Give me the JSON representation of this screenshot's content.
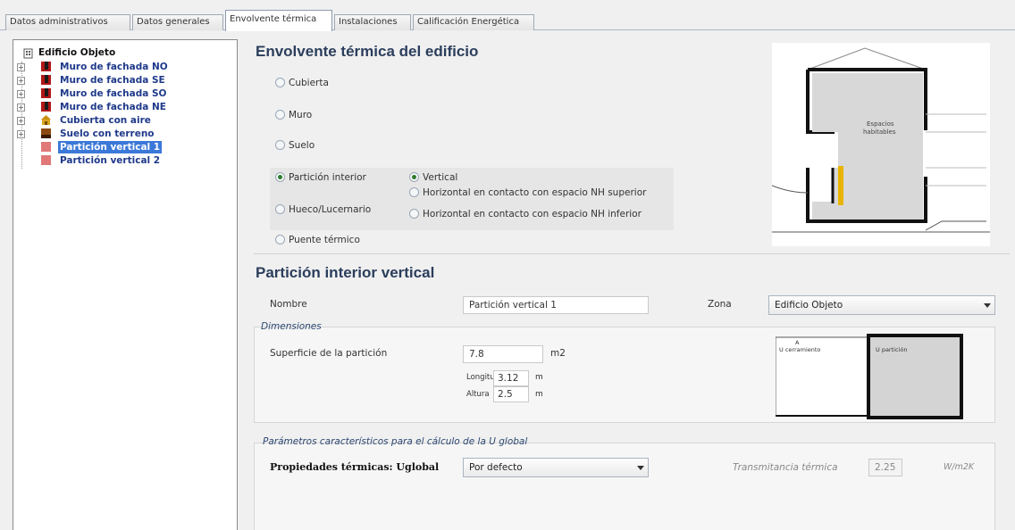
{
  "tabs": [
    "Datos administrativos",
    "Datos generales",
    "Envolvente térmica",
    "Instalaciones",
    "Calificación Energética"
  ],
  "tree": {
    "root": "Edificio Objeto",
    "items": [
      {
        "label": "Muro de fachada NO",
        "icon": "wall-icon"
      },
      {
        "label": "Muro de fachada SE",
        "icon": "wall-icon"
      },
      {
        "label": "Muro de fachada SO",
        "icon": "wall-icon"
      },
      {
        "label": "Muro de fachada NE",
        "icon": "wall-icon"
      },
      {
        "label": "Cubierta con aire",
        "icon": "roof-icon"
      },
      {
        "label": "Suelo con terreno",
        "icon": "floor-icon"
      },
      {
        "label": "Partición vertical 1",
        "icon": "partition-icon",
        "selected": true
      },
      {
        "label": "Partición vertical 2",
        "icon": "partition-icon"
      }
    ]
  },
  "envelope": {
    "title": "Envolvente térmica del edificio",
    "types": [
      {
        "label": "Cubierta",
        "checked": false
      },
      {
        "label": "Muro",
        "checked": false
      },
      {
        "label": "Suelo",
        "checked": false
      },
      {
        "label": "Partición interior",
        "checked": true
      },
      {
        "label": "Hueco/Lucernario",
        "checked": false
      },
      {
        "label": "Puente térmico",
        "checked": false
      }
    ],
    "subtypes": [
      {
        "label": "Vertical",
        "checked": true
      },
      {
        "label": "Horizontal en contacto con espacio NH superior",
        "checked": false
      },
      {
        "label": "Horizontal en contacto con espacio NH inferior",
        "checked": false
      }
    ],
    "diagram": {
      "label_line1": "Espacios",
      "label_line2": "habitables"
    }
  },
  "partition": {
    "title": "Partición interior vertical",
    "name_label": "Nombre",
    "name_value": "Partición vertical 1",
    "zone_label": "Zona",
    "zone_value": "Edificio Objeto",
    "dimensions": {
      "title": "Dimensiones",
      "surface_label": "Superficie de la partición",
      "surface_value": "7.8",
      "surface_unit": "m2",
      "length_label": "Longitud",
      "length_value": "3.12",
      "length_unit": "m",
      "height_label": "Altura",
      "height_value": "2.5",
      "height_unit": "m",
      "preview_left": "U cerramiento",
      "preview_right": "U partición",
      "preview_top": "A"
    },
    "params": {
      "title": "Parámetros característicos para el cálculo de la U global",
      "props_label": "Propiedades térmicas: Uglobal",
      "props_value": "Por defecto",
      "transmittance_label": "Transmitancia térmica",
      "transmittance_value": "2.25",
      "transmittance_unit": "W/m2K"
    }
  },
  "colors": {
    "accent": "#2b3e5c",
    "selection": "#3b78d8",
    "tree_text": "#1f3a8a",
    "highlight": "#e8b400"
  }
}
